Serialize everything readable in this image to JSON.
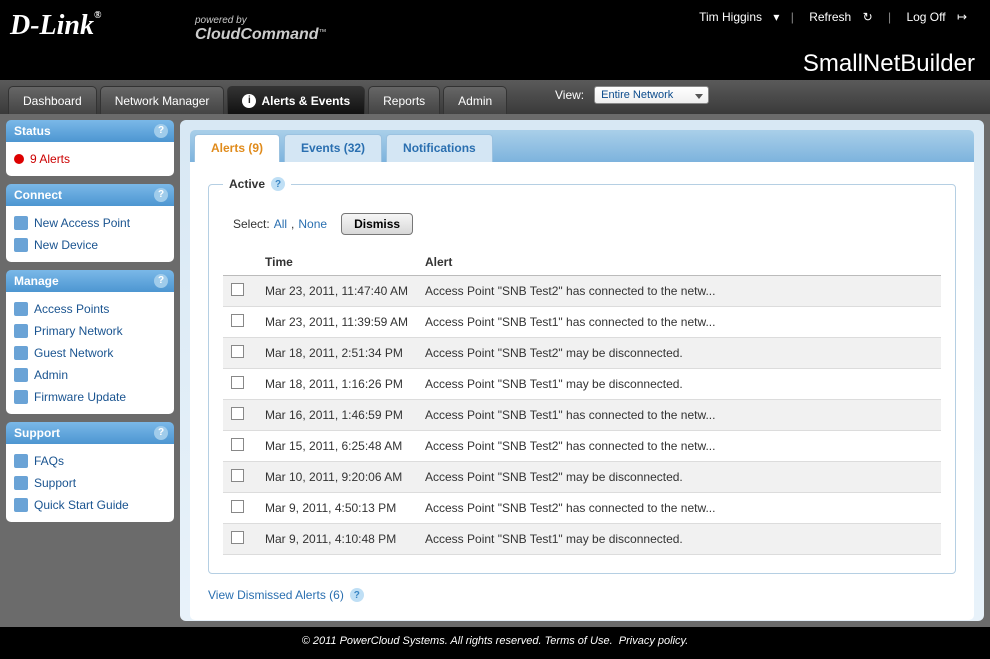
{
  "header": {
    "logo_text": "D-Link",
    "cloud_prefix": "powered by",
    "cloud_main": "CloudCommand",
    "username": "Tim Higgins",
    "refresh_label": "Refresh",
    "logoff_label": "Log Off",
    "network_title": "SmallNetBuilder"
  },
  "nav": {
    "tabs": [
      {
        "label": "Dashboard",
        "active": false
      },
      {
        "label": "Network Manager",
        "active": false
      },
      {
        "label": "Alerts & Events",
        "active": true,
        "icon": true
      },
      {
        "label": "Reports",
        "active": false
      },
      {
        "label": "Admin",
        "active": false
      }
    ],
    "view_label": "View:",
    "view_value": "Entire Network"
  },
  "sidebar": {
    "status": {
      "title": "Status",
      "alert_count_label": "9 Alerts"
    },
    "connect": {
      "title": "Connect",
      "items": [
        "New Access Point",
        "New Device"
      ]
    },
    "manage": {
      "title": "Manage",
      "items": [
        "Access Points",
        "Primary Network",
        "Guest Network",
        "Admin",
        "Firmware Update"
      ]
    },
    "support": {
      "title": "Support",
      "items": [
        "FAQs",
        "Support",
        "Quick Start Guide"
      ]
    }
  },
  "content": {
    "tabs": {
      "alerts": "Alerts (9)",
      "events": "Events (32)",
      "notifications": "Notifications"
    },
    "legend": "Active",
    "select_label": "Select:",
    "select_all": "All",
    "select_none": "None",
    "dismiss_label": "Dismiss",
    "col_time": "Time",
    "col_alert": "Alert",
    "rows": [
      {
        "time": "Mar 23, 2011, 11:47:40 AM",
        "alert": "Access Point \"SNB Test2\" has connected to the netw..."
      },
      {
        "time": "Mar 23, 2011, 11:39:59 AM",
        "alert": "Access Point \"SNB Test1\" has connected to the netw..."
      },
      {
        "time": "Mar 18, 2011, 2:51:34 PM",
        "alert": "Access Point \"SNB Test2\" may be disconnected."
      },
      {
        "time": "Mar 18, 2011, 1:16:26 PM",
        "alert": "Access Point \"SNB Test1\" may be disconnected."
      },
      {
        "time": "Mar 16, 2011, 1:46:59 PM",
        "alert": "Access Point \"SNB Test1\" has connected to the netw..."
      },
      {
        "time": "Mar 15, 2011, 6:25:48 AM",
        "alert": "Access Point \"SNB Test2\" has connected to the netw..."
      },
      {
        "time": "Mar 10, 2011, 9:20:06 AM",
        "alert": "Access Point \"SNB Test2\" may be disconnected."
      },
      {
        "time": "Mar 9, 2011, 4:50:13 PM",
        "alert": "Access Point \"SNB Test2\" has connected to the netw..."
      },
      {
        "time": "Mar 9, 2011, 4:10:48 PM",
        "alert": "Access Point \"SNB Test1\" may be disconnected."
      }
    ],
    "dismissed_link": "View Dismissed Alerts (6)"
  },
  "footer": {
    "copyright": "© 2011 PowerCloud Systems. All rights reserved.",
    "terms": "Terms of Use",
    "privacy": "Privacy policy",
    "dot": "."
  }
}
